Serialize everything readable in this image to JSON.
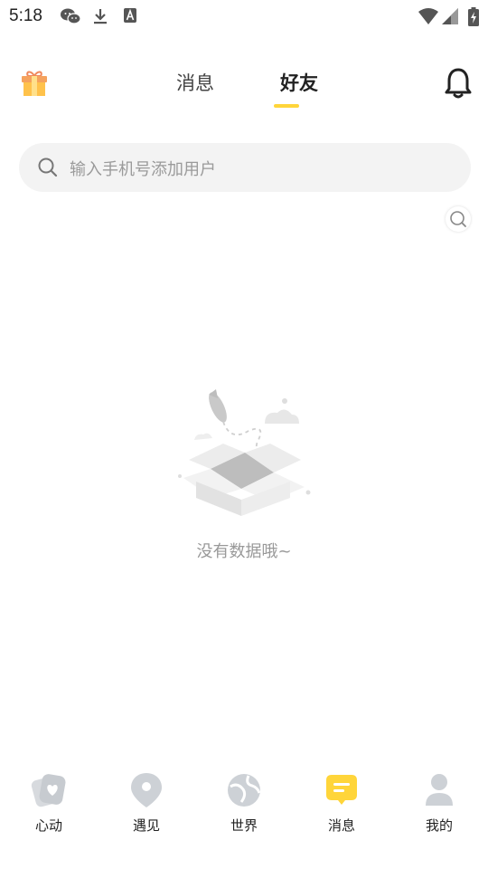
{
  "status_bar": {
    "time": "5:18",
    "left_icons": [
      "wechat-icon",
      "download-icon",
      "a-badge-icon"
    ],
    "right_icons": [
      "wifi-icon",
      "signal-icon",
      "battery-icon"
    ]
  },
  "header": {
    "tabs": [
      {
        "label": "消息",
        "active": false
      },
      {
        "label": "好友",
        "active": true
      }
    ],
    "left_icon": "gift-icon",
    "right_icon": "bell-icon"
  },
  "search": {
    "placeholder": "输入手机号添加用户"
  },
  "empty_state": {
    "text": "没有数据哦~"
  },
  "bottom_nav": {
    "items": [
      {
        "label": "心动",
        "icon": "heart-card-icon",
        "active": false
      },
      {
        "label": "遇见",
        "icon": "location-pin-icon",
        "active": false
      },
      {
        "label": "世界",
        "icon": "globe-icon",
        "active": false
      },
      {
        "label": "消息",
        "icon": "message-bubble-icon",
        "active": true
      },
      {
        "label": "我的",
        "icon": "person-icon",
        "active": false
      }
    ]
  },
  "colors": {
    "accent": "#FFD53A",
    "inactive_icon": "#cfd3d8",
    "text_muted": "#999999"
  }
}
